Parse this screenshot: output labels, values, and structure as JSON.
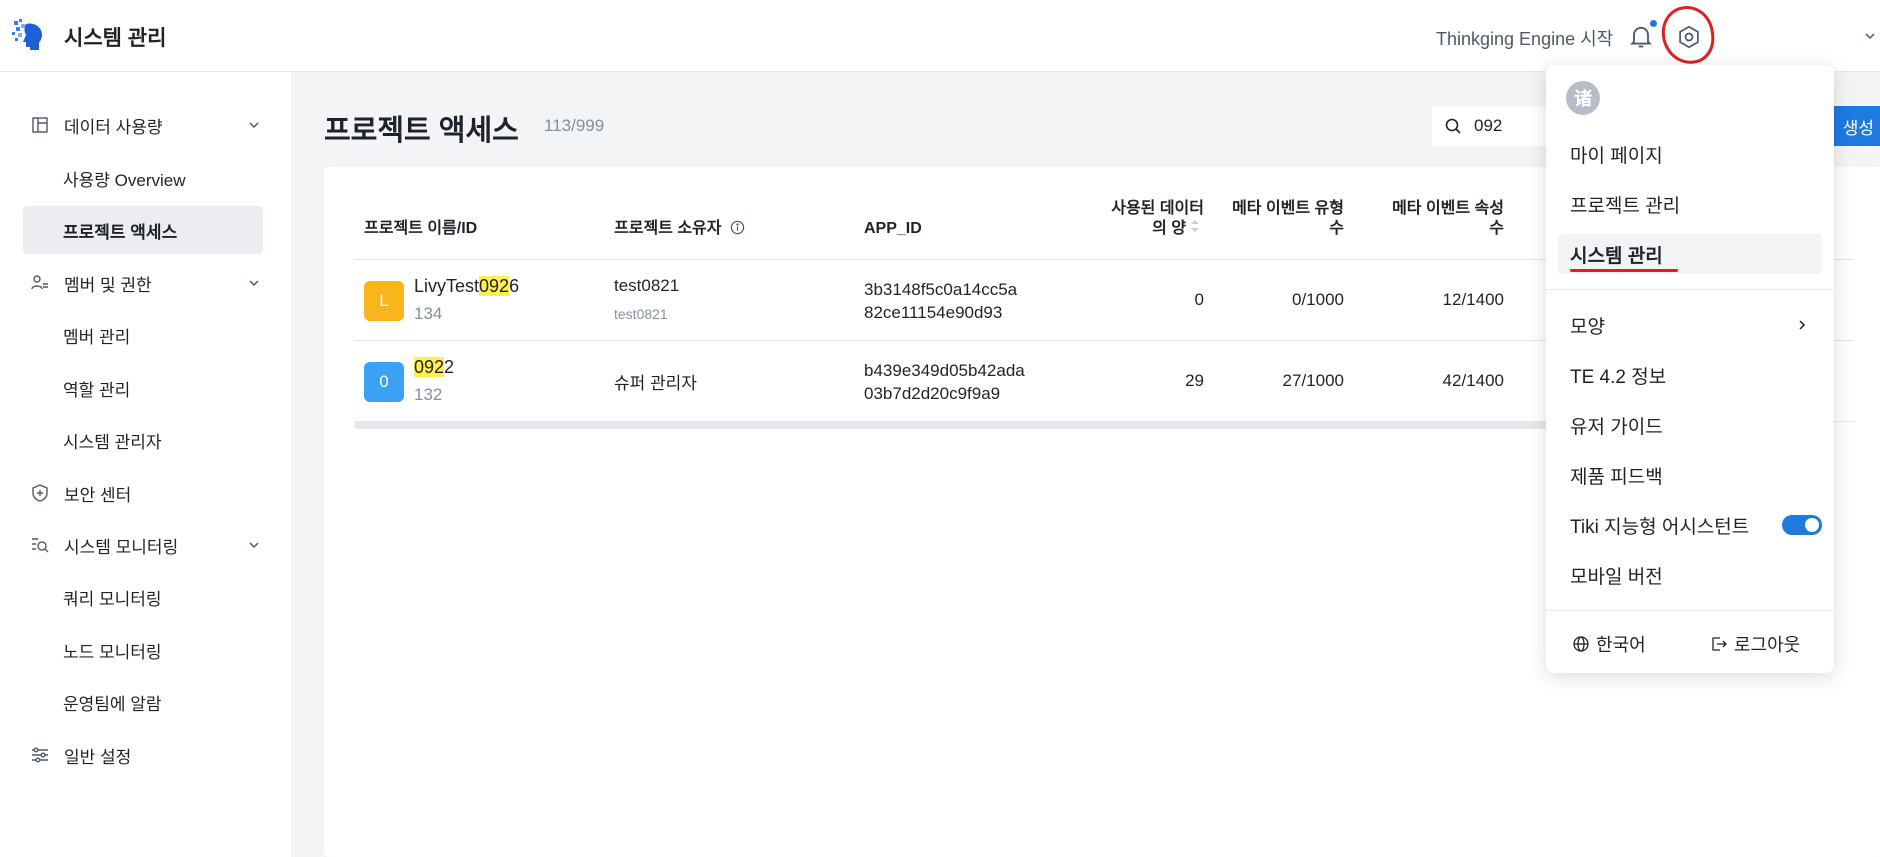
{
  "header": {
    "app_title": "시스템 관리",
    "start_link": "Thinkging Engine 시작"
  },
  "sidebar": {
    "groups": [
      {
        "label": "데이터 사용량",
        "icon": "table-icon"
      },
      {
        "label": "멤버 및 권한",
        "icon": "users-icon"
      },
      {
        "label": "보안 센터",
        "icon": "shield-icon"
      },
      {
        "label": "시스템 모니터링",
        "icon": "monitor-search-icon"
      },
      {
        "label": "일반 설정",
        "icon": "sliders-icon"
      }
    ],
    "items": [
      {
        "label": "사용량 Overview"
      },
      {
        "label": "프로젝트 액세스"
      },
      {
        "label": "멤버 관리"
      },
      {
        "label": "역할 관리"
      },
      {
        "label": "시스템 관리자"
      },
      {
        "label": "쿼리 모니터링"
      },
      {
        "label": "노드 모니터링"
      },
      {
        "label": "운영팀에 알람"
      }
    ]
  },
  "main": {
    "title": "프로젝트 액세스",
    "count": "113/999",
    "search_value": "092",
    "create_label": "생성"
  },
  "table": {
    "headers": {
      "name": "프로젝트 이름/ID",
      "owner": "프로젝트 소유자",
      "app_id": "APP_ID",
      "data_used_1": "사용된 데이터",
      "data_used_2": "의 양",
      "meta_type_1": "메타 이벤트 유형",
      "meta_type_2": "수",
      "meta_prop_1": "메타 이벤트 속성",
      "meta_prop_2": "수"
    },
    "rows": [
      {
        "avatar": "L",
        "avatar_color": "#fab51d",
        "name_pre": "LivyTest",
        "name_hl": "092",
        "name_post": "6",
        "id": "134",
        "owner": "test0821",
        "owner_sub": "test0821",
        "app_id_1": "3b3148f5c0a14cc5a",
        "app_id_2": "82ce11154e90d93",
        "data_used": "0",
        "meta_type": "0/1000",
        "meta_prop": "12/1400"
      },
      {
        "avatar": "0",
        "avatar_color": "#3ba1f5",
        "name_pre": "",
        "name_hl": "092",
        "name_post": "2",
        "id": "132",
        "owner": "슈퍼 관리자",
        "owner_sub": "",
        "app_id_1": "b439e349d05b42ada",
        "app_id_2": "03b7d2d20c9f9a9",
        "data_used": "29",
        "meta_type": "27/1000",
        "meta_prop": "42/1400"
      }
    ]
  },
  "dropdown": {
    "avatar_char": "诸",
    "items": {
      "my_page": "마이 페이지",
      "project_mgmt": "프로젝트 관리",
      "system_mgmt": "시스템 관리",
      "appearance": "모양",
      "te_info": "TE 4.2 정보",
      "user_guide": "유저 가이드",
      "feedback": "제품 피드백",
      "tiki": "Tiki 지능형 어시스턴트",
      "mobile": "모바일 버전"
    },
    "language": "한국어",
    "logout": "로그아웃"
  }
}
